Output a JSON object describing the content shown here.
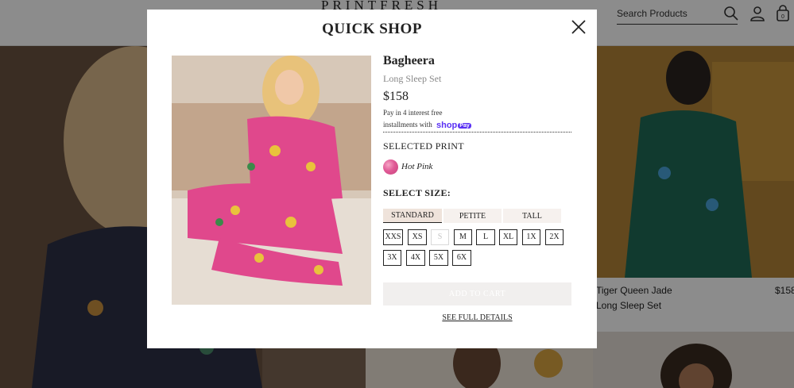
{
  "header": {
    "brand": "PRINTFRESH",
    "search_placeholder": "Search Products"
  },
  "background_products": [
    {
      "name": "Tiger Queen Jade",
      "price": "$158",
      "subtitle": "Long Sleep Set"
    }
  ],
  "modal": {
    "title": "QUICK SHOP",
    "product": {
      "name": "Bagheera",
      "subtitle": "Long Sleep Set",
      "price": "$158",
      "pay_line1": "Pay in 4 interest free",
      "pay_line2": "installments with",
      "shop_pay_word": "shop",
      "shop_pay_badge": "Pay"
    },
    "print": {
      "label": "SELECTED PRINT",
      "selected": "Hot Pink",
      "swatch_color": "#e05a96"
    },
    "size": {
      "label": "SELECT SIZE:",
      "tabs": [
        "STANDARD",
        "PETITE",
        "TALL"
      ],
      "active_tab": "STANDARD",
      "sizes": [
        "XXS",
        "XS",
        "S",
        "M",
        "L",
        "XL",
        "1X",
        "2X",
        "3X",
        "4X",
        "5X",
        "6X"
      ],
      "unavailable": [
        "S"
      ]
    },
    "add_to_cart": "ADD TO CART",
    "full_details": "SEE FULL DETAILS"
  },
  "colors": {
    "accent_shop_pay": "#5a31f4",
    "print_pink": "#e0488c",
    "overlay": "rgba(0,0,0,0.45)"
  }
}
